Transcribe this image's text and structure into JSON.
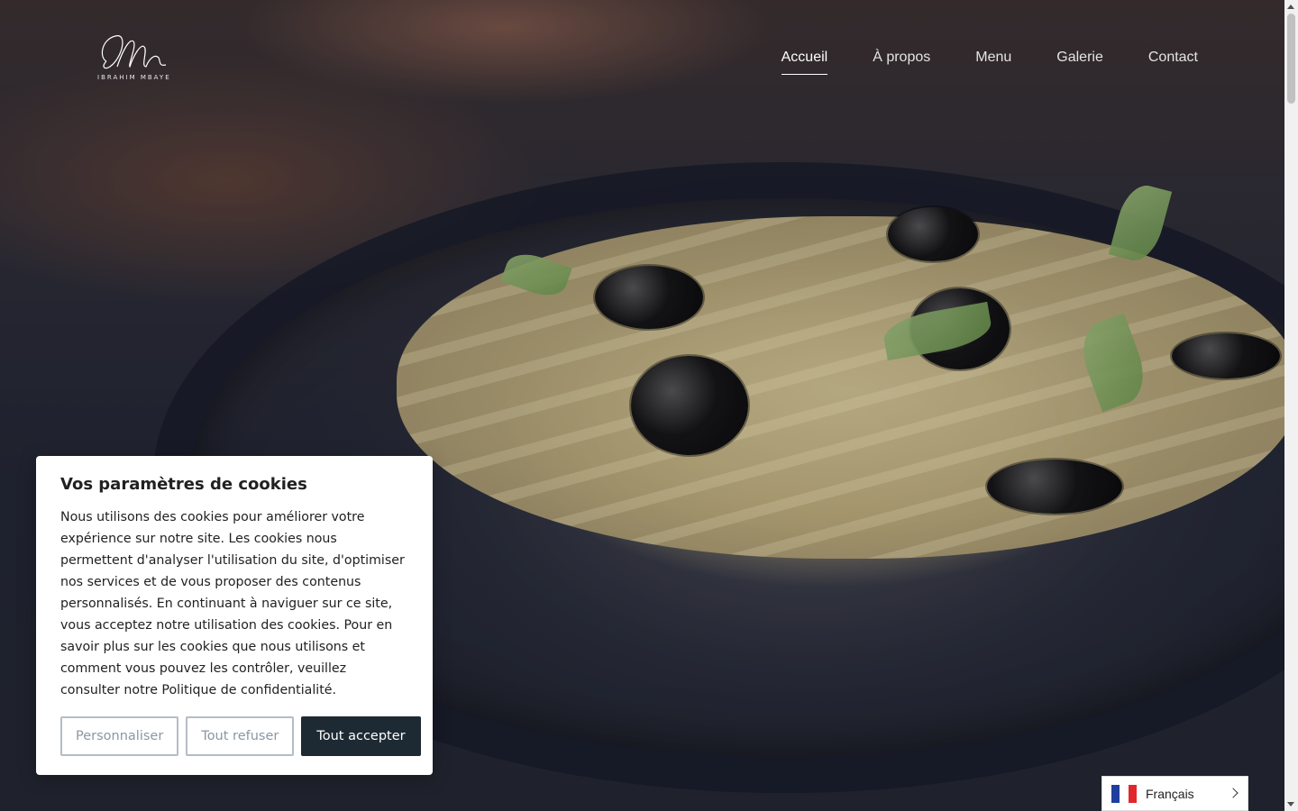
{
  "brand": {
    "logo_text": "IBRAHIM MBAYE"
  },
  "nav": {
    "items": [
      {
        "label": "Accueil",
        "active": true
      },
      {
        "label": "À propos",
        "active": false
      },
      {
        "label": "Menu",
        "active": false
      },
      {
        "label": "Galerie",
        "active": false
      },
      {
        "label": "Contact",
        "active": false
      }
    ]
  },
  "cookie": {
    "title": "Vos paramètres de cookies",
    "body": "Nous utilisons des cookies pour améliorer votre expérience sur notre site. Les cookies nous permettent d'analyser l'utilisation du site, d'optimiser nos services et de vous proposer des contenus personnalisés. En continuant à naviguer sur ce site, vous acceptez notre utilisation des cookies. Pour en savoir plus sur les cookies que nous utilisons et comment vous pouvez les contrôler, veuillez consulter notre Politique de confidentialité.",
    "customize_label": "Personnaliser",
    "reject_label": "Tout refuser",
    "accept_label": "Tout accepter"
  },
  "language": {
    "label": "Français",
    "flag_icon": "france-flag-icon"
  },
  "colors": {
    "primary_button": "#1e2a33",
    "nav_text": "#ffffff"
  }
}
